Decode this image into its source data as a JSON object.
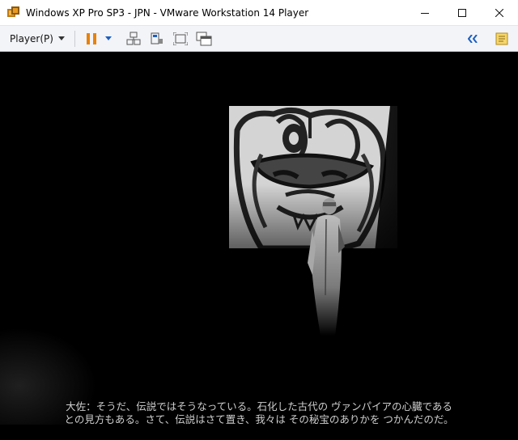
{
  "window": {
    "title": "Windows XP Pro SP3 - JPN - VMware Workstation 14 Player",
    "controls": {
      "minimize": "─",
      "maximize": "☐",
      "close": "✕"
    }
  },
  "toolbar": {
    "player_menu_label": "Player(P)",
    "icons": [
      "pause-icon",
      "dropdown-arrow-icon",
      "network-icon",
      "removable-device-icon",
      "fullscreen-icon",
      "unity-icon"
    ],
    "right_icons": [
      "collapse-double-chevron-icon",
      "notes-icon"
    ],
    "accent_color": "#1b5fc1",
    "pause_color": "#e8820c"
  },
  "vm": {
    "subtitle_line1": "大佐：そうだ、伝説ではそうなっている。石化した古代の ヴァンパイアの心臓である",
    "subtitle_line2": "との見方もある。さて、伝説はさて置き、我々は その秘宝のありかを つかんだのだ。"
  }
}
